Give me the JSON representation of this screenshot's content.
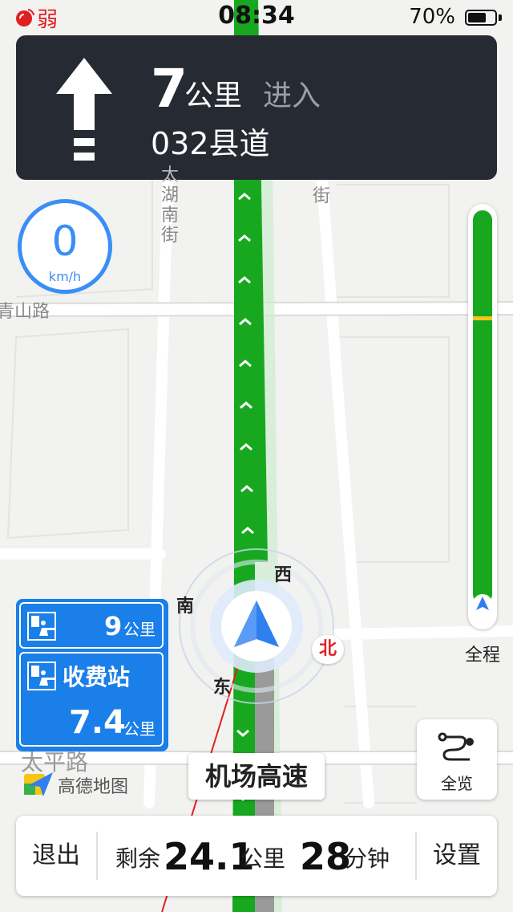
{
  "status_bar": {
    "signal_label": "弱",
    "time": "08:34",
    "battery_percent": "70%",
    "battery_level": 0.7
  },
  "instruction": {
    "distance_value": "7",
    "distance_unit": "公里",
    "action": "进入",
    "road": "032县道",
    "turn_icon": "straight-arrow-icon"
  },
  "speed": {
    "value": "0",
    "unit": "km/h"
  },
  "map_labels": {
    "road_vertical_left": [
      "太",
      "湖",
      "南",
      "街"
    ],
    "road_vertical_right": "街",
    "road_horizontal": "青山路",
    "road_bottom": "太平路"
  },
  "compass": {
    "west": "西",
    "south": "南",
    "east": "东",
    "north": "北"
  },
  "route_progress": {
    "label": "全程",
    "completed_fraction": 0.0,
    "yellow_marker_fraction": 0.27
  },
  "tolls": [
    {
      "distance": "9",
      "unit": "公里",
      "icon": "toll-booth-icon"
    },
    {
      "name": "收费站",
      "distance": "7.4",
      "unit": "公里",
      "icon": "toll-booth-icon"
    }
  ],
  "overview_button": {
    "label": "全览",
    "icon": "route-overview-icon"
  },
  "current_road": "机场高速",
  "brand": {
    "text": "高德地图"
  },
  "bottom_bar": {
    "exit_label": "退出",
    "remaining_label": "剩余",
    "remaining_distance": "24.1",
    "remaining_distance_unit": "公里",
    "remaining_time": "28",
    "remaining_time_unit": "分钟",
    "settings_label": "设置"
  },
  "colors": {
    "route_green": "#18a81f",
    "panel_dark": "#262a33",
    "accent_blue": "#3a8ef6",
    "toll_blue": "#1a7fe8",
    "alert_red": "#e02020"
  }
}
